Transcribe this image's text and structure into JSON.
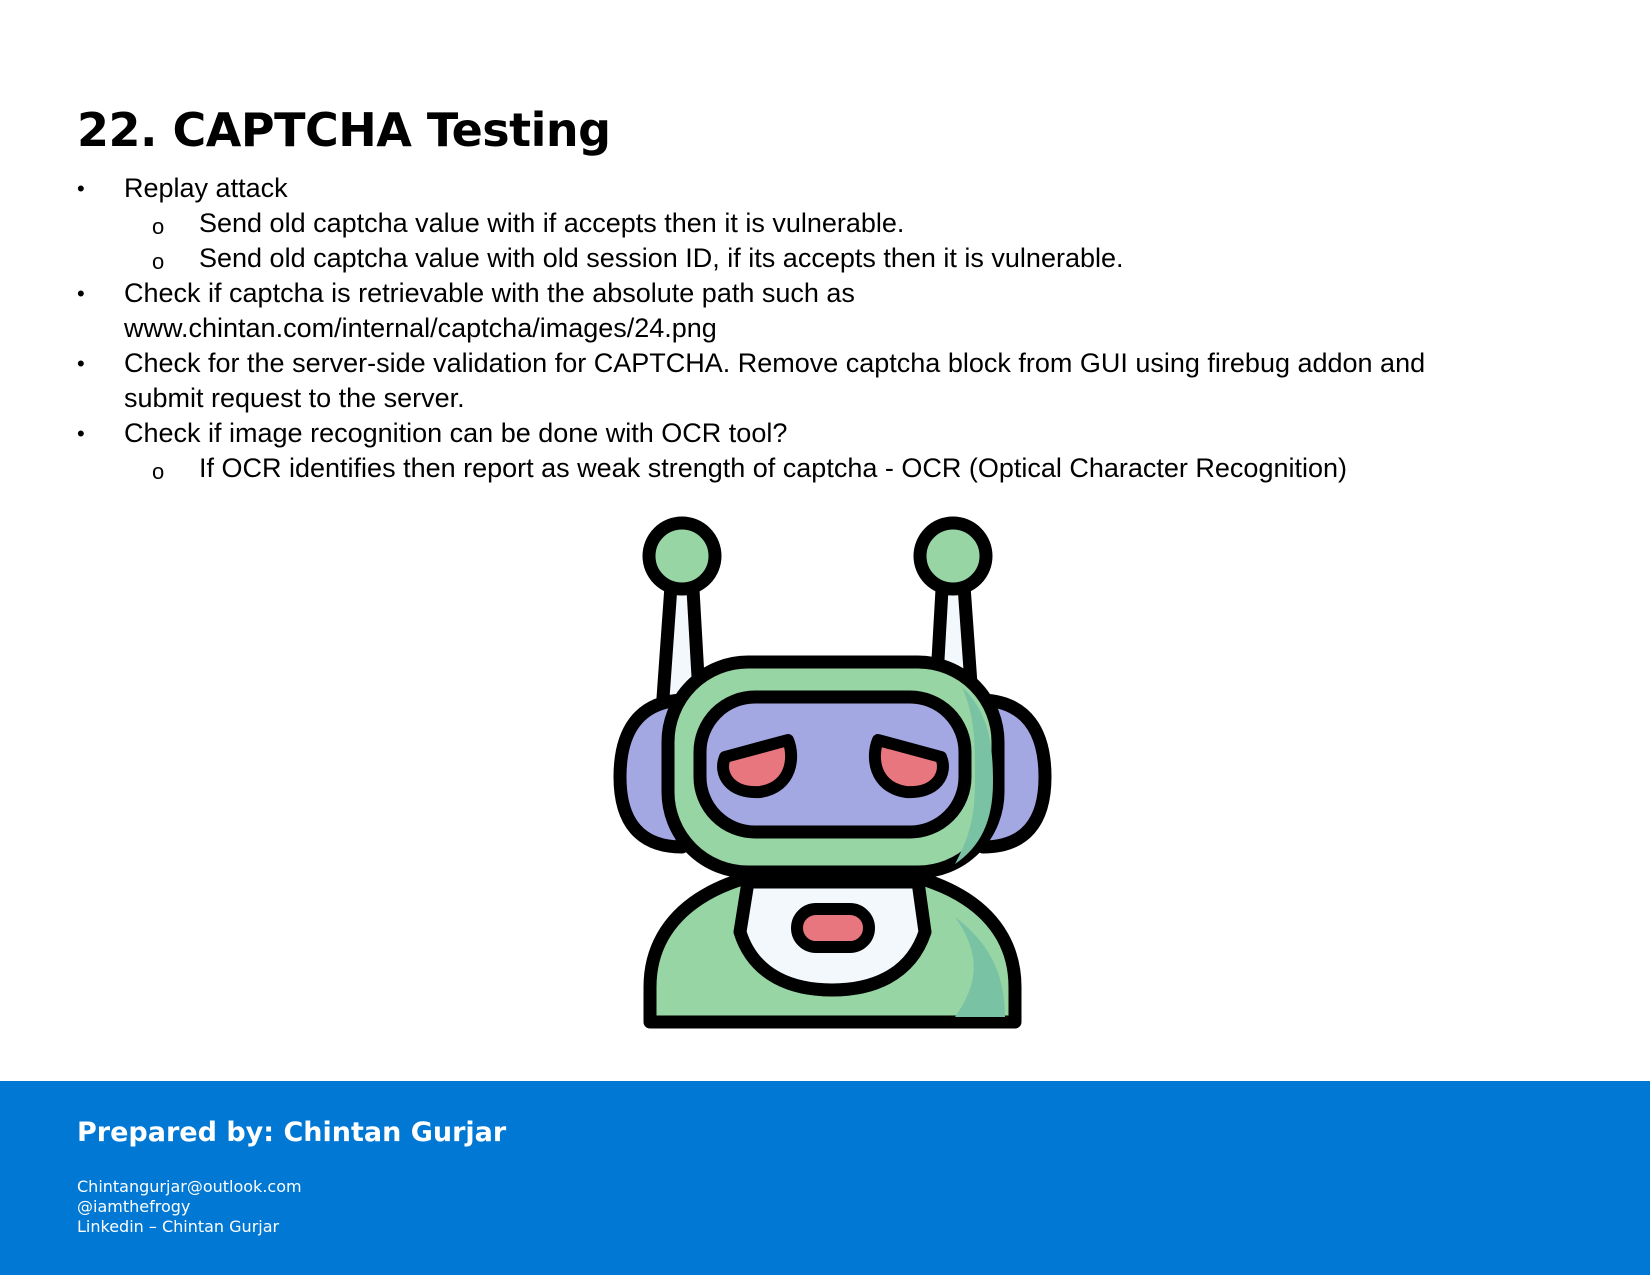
{
  "title": "22. CAPTCHA Testing",
  "bullets": [
    {
      "text": "Replay attack",
      "sub": [
        "Send old captcha value with if accepts then it is vulnerable.",
        "Send old captcha value with old session ID, if its accepts then it is vulnerable."
      ]
    },
    {
      "text": "Check if captcha is retrievable with the absolute path such as",
      "text_line2": "www.chintan.com/internal/captcha/images/24.png"
    },
    {
      "text": "Check for the server-side validation for CAPTCHA. Remove captcha block from GUI using firebug addon and",
      "text_line2": "submit request to the server."
    },
    {
      "text": "Check if image recognition can be done with OCR tool?",
      "sub": [
        "If OCR identifies then report as weak strength of captcha -  OCR (Optical Character Recognition)"
      ]
    }
  ],
  "markers": {
    "bullet": "•",
    "sub_bullet": "o"
  },
  "illustration": {
    "icon": "angry-robot-icon"
  },
  "footer": {
    "heading": "Prepared by: Chintan Gurjar",
    "email": "Chintangurjar@outlook.com",
    "handle": "@iamthefrogy",
    "linkedin": "Linkedin – Chintan Gurjar"
  },
  "colors": {
    "footer_bg": "#0078d4",
    "robot_green": "#97d5a4",
    "robot_green_shade": "#79c2a4",
    "robot_purple": "#a3a8e3",
    "robot_red": "#e8767f",
    "robot_white": "#f3f8fc",
    "outline": "#000000"
  }
}
